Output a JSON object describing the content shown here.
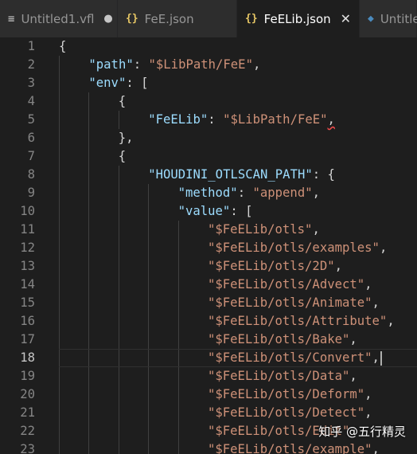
{
  "tabs": [
    {
      "label": "Untitled1.vfl",
      "icon": "menu-icon",
      "icon_glyph": "≡",
      "status": "●",
      "active": false
    },
    {
      "label": "FeE.json",
      "icon": "json-icon",
      "icon_glyph": "{}",
      "status": "",
      "active": false
    },
    {
      "label": "FeELib.json",
      "icon": "json-icon",
      "icon_glyph": "{}",
      "status": "✕",
      "active": true
    },
    {
      "label": "Untitle",
      "icon": "python-icon",
      "icon_glyph": "◆",
      "status": "",
      "active": false
    }
  ],
  "editor": {
    "current_line": 18,
    "lines": [
      {
        "n": "1",
        "indent": 0,
        "parts": [
          [
            "p",
            "{"
          ]
        ]
      },
      {
        "n": "2",
        "indent": 1,
        "parts": [
          [
            "k",
            "\"path\""
          ],
          [
            "p",
            ": "
          ],
          [
            "s",
            "\"$LibPath/FeE\""
          ],
          [
            "p",
            ","
          ]
        ]
      },
      {
        "n": "3",
        "indent": 1,
        "parts": [
          [
            "k",
            "\"env\""
          ],
          [
            "p",
            ": ["
          ]
        ]
      },
      {
        "n": "4",
        "indent": 2,
        "parts": [
          [
            "p",
            "{"
          ]
        ]
      },
      {
        "n": "5",
        "indent": 3,
        "parts": [
          [
            "k",
            "\"FeELib\""
          ],
          [
            "p",
            ": "
          ],
          [
            "s",
            "\"$LibPath/FeE\""
          ],
          [
            "q",
            ","
          ]
        ]
      },
      {
        "n": "6",
        "indent": 2,
        "parts": [
          [
            "p",
            "},"
          ]
        ]
      },
      {
        "n": "7",
        "indent": 2,
        "parts": [
          [
            "p",
            "{"
          ]
        ]
      },
      {
        "n": "8",
        "indent": 3,
        "parts": [
          [
            "k",
            "\"HOUDINI_OTLSCAN_PATH\""
          ],
          [
            "p",
            ": {"
          ]
        ]
      },
      {
        "n": "9",
        "indent": 4,
        "parts": [
          [
            "k",
            "\"method\""
          ],
          [
            "p",
            ": "
          ],
          [
            "s",
            "\"append\""
          ],
          [
            "p",
            ","
          ]
        ]
      },
      {
        "n": "10",
        "indent": 4,
        "parts": [
          [
            "k",
            "\"value\""
          ],
          [
            "p",
            ": ["
          ]
        ]
      },
      {
        "n": "11",
        "indent": 5,
        "parts": [
          [
            "s",
            "\"$FeELib/otls\""
          ],
          [
            "p",
            ","
          ]
        ]
      },
      {
        "n": "12",
        "indent": 5,
        "parts": [
          [
            "s",
            "\"$FeELib/otls/examples\""
          ],
          [
            "p",
            ","
          ]
        ]
      },
      {
        "n": "13",
        "indent": 5,
        "parts": [
          [
            "s",
            "\"$FeELib/otls/2D\""
          ],
          [
            "p",
            ","
          ]
        ]
      },
      {
        "n": "14",
        "indent": 5,
        "parts": [
          [
            "s",
            "\"$FeELib/otls/Advect\""
          ],
          [
            "p",
            ","
          ]
        ]
      },
      {
        "n": "15",
        "indent": 5,
        "parts": [
          [
            "s",
            "\"$FeELib/otls/Animate\""
          ],
          [
            "p",
            ","
          ]
        ]
      },
      {
        "n": "16",
        "indent": 5,
        "parts": [
          [
            "s",
            "\"$FeELib/otls/Attribute\""
          ],
          [
            "p",
            ","
          ]
        ]
      },
      {
        "n": "17",
        "indent": 5,
        "parts": [
          [
            "s",
            "\"$FeELib/otls/Bake\""
          ],
          [
            "p",
            ","
          ]
        ]
      },
      {
        "n": "18",
        "indent": 5,
        "parts": [
          [
            "s",
            "\"$FeELib/otls/Convert\""
          ],
          [
            "p",
            ","
          ]
        ]
      },
      {
        "n": "19",
        "indent": 5,
        "parts": [
          [
            "s",
            "\"$FeELib/otls/Data\""
          ],
          [
            "p",
            ","
          ]
        ]
      },
      {
        "n": "20",
        "indent": 5,
        "parts": [
          [
            "s",
            "\"$FeELib/otls/Deform\""
          ],
          [
            "p",
            ","
          ]
        ]
      },
      {
        "n": "21",
        "indent": 5,
        "parts": [
          [
            "s",
            "\"$FeELib/otls/Detect\""
          ],
          [
            "p",
            ","
          ]
        ]
      },
      {
        "n": "22",
        "indent": 5,
        "parts": [
          [
            "s",
            "\"$FeELib/otls/Edit\""
          ]
        ]
      },
      {
        "n": "23",
        "indent": 5,
        "parts": [
          [
            "s",
            "\"$FeELib/otls/example\""
          ],
          [
            "p",
            ","
          ]
        ]
      }
    ]
  },
  "watermark": "知乎 @五行精灵",
  "colors": {
    "key": "#9cdcfe",
    "string": "#ce9178",
    "punctuation": "#d4d4d4",
    "background": "#1e1e1e",
    "line_number": "#858585"
  }
}
